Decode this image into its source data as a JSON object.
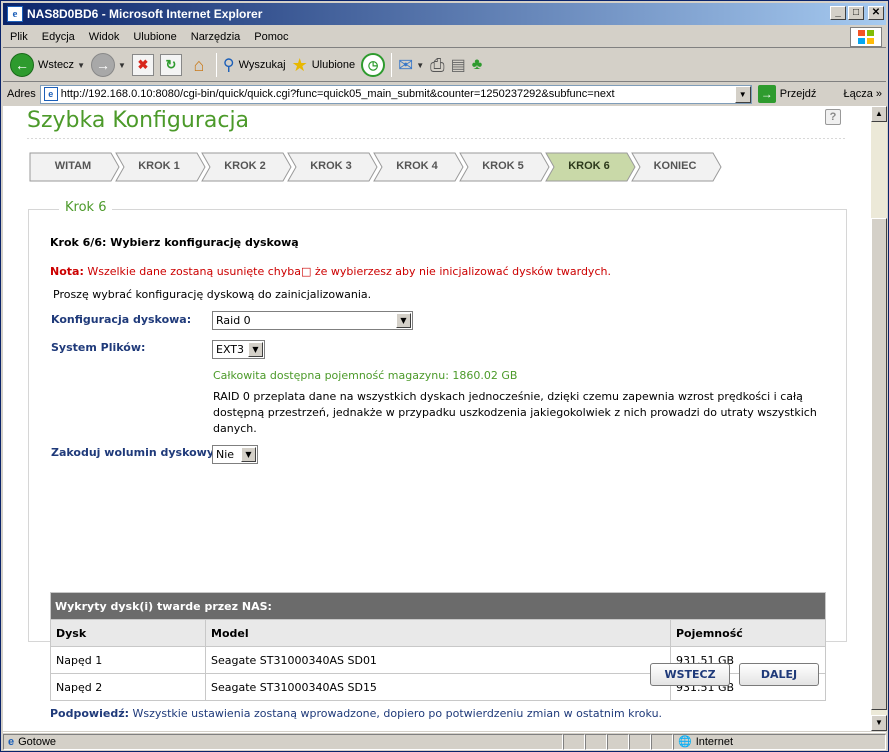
{
  "window": {
    "title": "NAS8D0BD6 - Microsoft Internet Explorer"
  },
  "menu": [
    {
      "label": "Plik"
    },
    {
      "label": "Edycja"
    },
    {
      "label": "Widok"
    },
    {
      "label": "Ulubione"
    },
    {
      "label": "Narzędzia"
    },
    {
      "label": "Pomoc"
    }
  ],
  "toolbar": {
    "back_label": "Wstecz",
    "search_label": "Wyszukaj",
    "favorites_label": "Ulubione"
  },
  "address": {
    "label": "Adres",
    "url": "http://192.168.0.10:8080/cgi-bin/quick/quick.cgi?func=quick05_main_submit&counter=1250237292&subfunc=next",
    "go_label": "Przejdź",
    "links_label": "Łącza"
  },
  "page": {
    "title": "Szybka Konfiguracja",
    "steps": [
      {
        "label": "WITAM",
        "active": false
      },
      {
        "label": "KROK 1",
        "active": false
      },
      {
        "label": "KROK 2",
        "active": false
      },
      {
        "label": "KROK 3",
        "active": false
      },
      {
        "label": "KROK 4",
        "active": false
      },
      {
        "label": "KROK 5",
        "active": false
      },
      {
        "label": "KROK 6",
        "active": true
      },
      {
        "label": "KONIEC",
        "active": false
      }
    ],
    "legend": "Krok 6",
    "heading": "Krok 6/6: Wybierz konfigurację dyskową",
    "note_prefix": "Nota:",
    "note_text": " Wszelkie dane zostaną usunięte chyba□ że wybierzesz aby nie inicjalizować dysków twardych.",
    "intro": "Proszę wybrać konfigurację dyskową do zainicjalizowania.",
    "disk_config_label": "Konfiguracja dyskowa:",
    "disk_config_value": "Raid 0",
    "fs_label": "System Plików:",
    "fs_value": "EXT3",
    "capacity_text": "Całkowita dostępna pojemność magazynu: 1860.02 GB",
    "raid_desc_1": "RAID 0 przeplata dane na wszystkich dyskach jednocześnie, dzięki czemu zapewnia wzrost prędkości i całą",
    "raid_desc_2": "dostępną przestrzeń, jednakże w przypadku uszkodzenia jakiegokolwiek z nich prowadzi do utraty wszystkich",
    "raid_desc_3": "danych.",
    "encrypt_label": "Zakoduj wolumin dyskowy:",
    "encrypt_value": "Nie",
    "disks_title": "Wykryty dysk(i) twarde przez NAS:",
    "disks_headers": [
      "Dysk",
      "Model",
      "Pojemność"
    ],
    "disks": [
      {
        "disk": "Napęd 1",
        "model": "Seagate ST31000340AS SD01",
        "capacity": "931.51 GB"
      },
      {
        "disk": "Napęd 2",
        "model": "Seagate ST31000340AS SD15",
        "capacity": "931.51 GB"
      }
    ],
    "tip_prefix": "Podpowiedź:",
    "tip_text": " Wszystkie ustawienia zostaną wprowadzone, dopiero po potwierdzeniu zmian w ostatnim kroku.",
    "back_button": "WSTECZ",
    "next_button": "DALEJ"
  },
  "status": {
    "left": "Gotowe",
    "zone": "Internet"
  },
  "colors": {
    "accent": "#4c9a2a",
    "step_active": "#c9d9a8",
    "label_blue": "#1f3a7a",
    "note_red": "#cc0000"
  }
}
